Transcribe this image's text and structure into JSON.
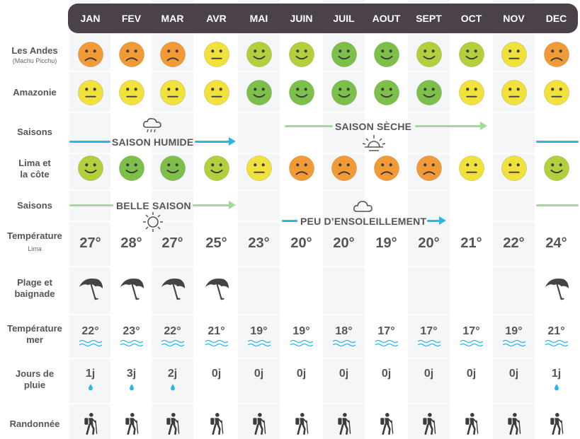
{
  "months": [
    "JAN",
    "FEV",
    "MAR",
    "AVR",
    "MAI",
    "JUIN",
    "JUIL",
    "AOUT",
    "SEPT",
    "OCT",
    "NOV",
    "DEC"
  ],
  "row_labels": {
    "andes": "Les Andes",
    "andes_sub": "(Machu Picchu)",
    "amazonie": "Amazonie",
    "saisons1": "Saisons",
    "lima_line1": "Lima et",
    "lima_line2": "la côte",
    "saisons2": "Saisons",
    "temp_line1": "Température",
    "temp_sub": "Lima",
    "plage_line1": "Plage et",
    "plage_line2": "baignade",
    "sea_line1": "Température",
    "sea_line2": "mer",
    "rain_line1": "Jours de",
    "rain_line2": "pluie",
    "rando": "Randonnée"
  },
  "mood_colors": {
    "good": "#7cc04a",
    "ok_good": "#b3cf3c",
    "neutral": "#f1e13b",
    "bad": "#f29a35"
  },
  "andes_moods": [
    "bad",
    "bad",
    "bad",
    "neutral",
    "ok_good",
    "ok_good",
    "good",
    "good",
    "ok_good",
    "ok_good",
    "neutral",
    "bad"
  ],
  "amazonie_moods": [
    "neutral",
    "neutral",
    "neutral",
    "neutral",
    "good",
    "good",
    "good",
    "good",
    "good",
    "neutral",
    "neutral",
    "neutral"
  ],
  "lima_moods": [
    "ok_good",
    "good",
    "good",
    "ok_good",
    "neutral",
    "bad",
    "bad",
    "bad",
    "bad",
    "neutral",
    "neutral",
    "ok_good"
  ],
  "seasons_andes": {
    "humide": "SAISON HUMIDE",
    "seche": "SAISON SÈCHE",
    "humide_icon": "rain-cloud-icon",
    "seche_icon": "sun-icon"
  },
  "seasons_lima": {
    "belle": "BELLE SAISON",
    "peu": "PEU D’ENSOLEILLEMENT",
    "belle_icon": "sun-icon",
    "peu_icon": "cloud-icon"
  },
  "line_colors": {
    "blue": "#29b6e8",
    "green": "#9fdc98"
  },
  "temperatures": [
    "27°",
    "28°",
    "27°",
    "25°",
    "23°",
    "20°",
    "20°",
    "19°",
    "20°",
    "21°",
    "22°",
    "24°"
  ],
  "beach": [
    true,
    true,
    true,
    true,
    false,
    false,
    false,
    false,
    false,
    false,
    false,
    true
  ],
  "sea_temperatures": [
    "22°",
    "23°",
    "22°",
    "21°",
    "19°",
    "19°",
    "18°",
    "17°",
    "17°",
    "17°",
    "19°",
    "21°"
  ],
  "rain_days": [
    "1j",
    "3j",
    "2j",
    "0j",
    "0j",
    "0j",
    "0j",
    "0j",
    "0j",
    "0j",
    "0j",
    "1j"
  ],
  "rain_drop": [
    true,
    true,
    true,
    false,
    false,
    false,
    false,
    false,
    false,
    false,
    false,
    true
  ],
  "hiking_icon": "hiker-icon"
}
